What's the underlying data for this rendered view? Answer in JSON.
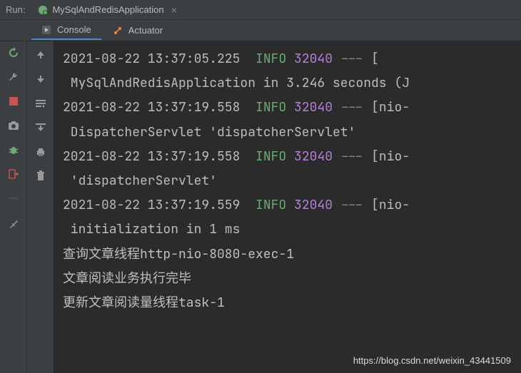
{
  "header": {
    "run_label": "Run:",
    "config_name": "MySqlAndRedisApplication",
    "close_glyph": "×"
  },
  "tabs": {
    "console": "Console",
    "actuator": "Actuator"
  },
  "colors": {
    "info": "#6aab73",
    "pid": "#b77fdb",
    "bg": "#2b2b2b"
  },
  "log": {
    "lines": [
      {
        "ts": "2021-08-22 13:37:05.225",
        "level": "INFO",
        "pid": "32040",
        "thread": "[",
        "cont": " MySqlAndRedisApplication in 3.246 seconds (J"
      },
      {
        "ts": "2021-08-22 13:37:19.558",
        "level": "INFO",
        "pid": "32040",
        "thread": "[nio-",
        "cont": " DispatcherServlet 'dispatcherServlet'"
      },
      {
        "ts": "2021-08-22 13:37:19.558",
        "level": "INFO",
        "pid": "32040",
        "thread": "[nio-",
        "cont": " 'dispatcherServlet'"
      },
      {
        "ts": "2021-08-22 13:37:19.559",
        "level": "INFO",
        "pid": "32040",
        "thread": "[nio-",
        "cont": " initialization in 1 ms"
      }
    ],
    "plain": [
      "查询文章线程http-nio-8080-exec-1",
      "文章阅读业务执行完毕",
      "更新文章阅读量线程task-1"
    ]
  },
  "watermark": "https://blog.csdn.net/weixin_43441509"
}
